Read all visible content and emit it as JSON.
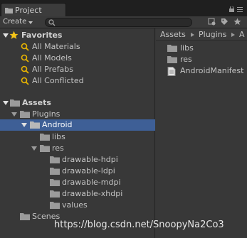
{
  "window": {
    "tab_title": "Project"
  },
  "toolbar": {
    "create_label": "Create",
    "search_placeholder": ""
  },
  "favorites": {
    "header": "Favorites",
    "items": [
      "All Materials",
      "All Models",
      "All Prefabs",
      "All Conflicted"
    ]
  },
  "assets": {
    "header": "Assets",
    "tree": {
      "plugins": "Plugins",
      "android": "Android",
      "libs": "libs",
      "res": "res",
      "res_children": [
        "drawable-hdpi",
        "drawable-ldpi",
        "drawable-mdpi",
        "drawable-xhdpi",
        "values"
      ],
      "scenes": "Scenes"
    }
  },
  "right_panel": {
    "breadcrumb": [
      "Assets",
      "Plugins",
      "A"
    ],
    "items": [
      "libs",
      "res",
      "AndroidManifest"
    ]
  },
  "watermark": "https://blog.csdn.net/SnoopyNa2Co3",
  "colors": {
    "selection": "#3e5f96",
    "panel_bg": "#383838",
    "star": "#f5c518",
    "search_icon": "#e8b400"
  }
}
